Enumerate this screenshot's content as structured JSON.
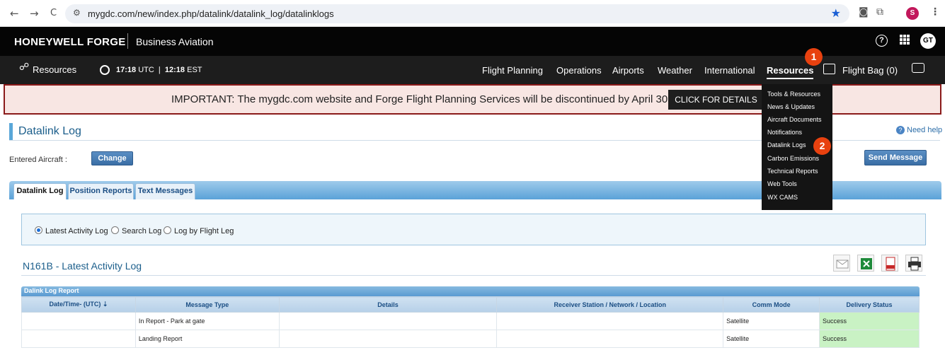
{
  "browser": {
    "url": "mygdc.com/new/index.php/datalink/datalink_log/datalinklogs",
    "back_glyph": "←",
    "forward_glyph": "→",
    "reload_glyph": "C",
    "profile_initial": "S"
  },
  "header": {
    "brand": "HONEYWELL FORGE",
    "sub": "Business Aviation",
    "help_glyph": "?",
    "avatar_initials": "GT"
  },
  "nav": {
    "resources_link": "Resources",
    "utc_time": "17:18",
    "utc_label": "UTC",
    "local_time": "12:18",
    "local_label": "EST",
    "items": [
      "Flight Planning",
      "Operations",
      "Airports",
      "Weather",
      "International",
      "Resources"
    ],
    "flight_bag": "Flight Bag (0)"
  },
  "banner": {
    "text": "IMPORTANT: The mygdc.com website and Forge Flight Planning Services will be discontinued by April 30, 2025",
    "button": "CLICK FOR DETAILS"
  },
  "page": {
    "title": "Datalink Log",
    "need_help": "Need help",
    "entered_aircraft_label": "Entered Aircraft :",
    "change_button": "Change",
    "send_message_button": "Send Message"
  },
  "tabs": [
    "Datalink Log",
    "Position Reports",
    "Text Messages"
  ],
  "radios": [
    "Latest Activity Log",
    "Search Log",
    "Log by Flight Leg"
  ],
  "section": {
    "title": "N161B - Latest Activity Log"
  },
  "table": {
    "caption": "Dalink Log Report",
    "columns": [
      "Date/Time- (UTC)",
      "Message Type",
      "Details",
      "Receiver Station / Network / Location",
      "Comm Mode",
      "Delivery Status"
    ],
    "rows": [
      {
        "message_type": "In Report - Park at gate",
        "comm_mode": "Satellite",
        "status": "Success"
      },
      {
        "message_type": "Landing Report",
        "comm_mode": "Satellite",
        "status": "Success"
      }
    ]
  },
  "dropdown": {
    "items": [
      "Tools & Resources",
      "News & Updates",
      "Aircraft Documents",
      "Notifications",
      "Datalink Logs",
      "Carbon Emissions",
      "Technical Reports",
      "Web Tools",
      "WX CAMS"
    ]
  },
  "markers": [
    "1",
    "2"
  ],
  "colors": {
    "accent_red": "#e8410f",
    "banner_border": "#8b1a1a",
    "link_blue": "#1b5e8b",
    "success_green": "#c9f2c4"
  }
}
